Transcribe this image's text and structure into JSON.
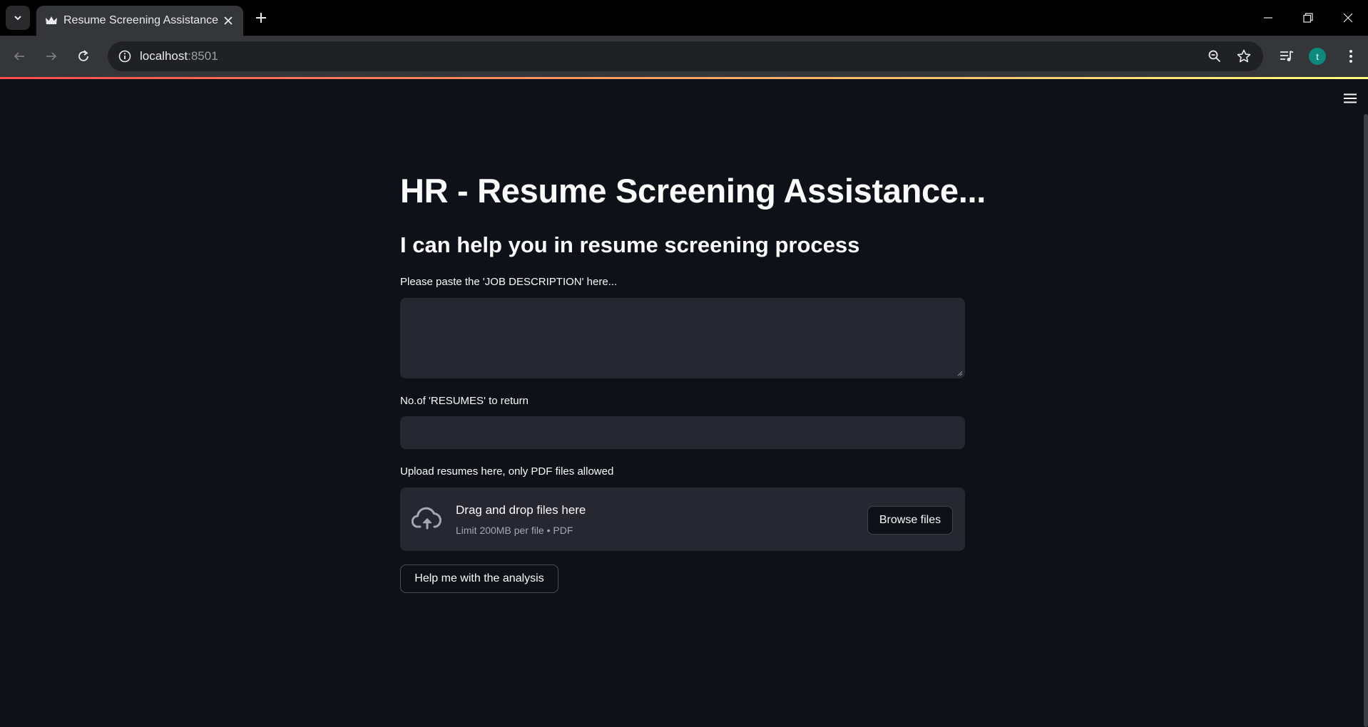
{
  "browser": {
    "tab_title": "Resume Screening Assistance",
    "url_host": "localhost",
    "url_port": ":8501",
    "profile_initial": "t"
  },
  "page": {
    "title": "HR - Resume Screening Assistance...",
    "subtitle": "I can help you in resume screening process",
    "job_description": {
      "label": "Please paste the 'JOB DESCRIPTION' here...",
      "value": ""
    },
    "num_resumes": {
      "label": "No.of 'RESUMES' to return",
      "value": ""
    },
    "uploader": {
      "label": "Upload resumes here, only PDF files allowed",
      "drop_text": "Drag and drop files here",
      "limit_text": "Limit 200MB per file • PDF",
      "browse_label": "Browse files"
    },
    "submit_label": "Help me with the analysis"
  },
  "colors": {
    "background": "#0e1117",
    "widget_bg": "#262730",
    "text": "#fafafa",
    "accent_gradient_start": "#ff4b4b",
    "accent_gradient_end": "#fffd80",
    "avatar": "#0b8a7d"
  },
  "icons": [
    "tab-search-icon",
    "streamlit-crown-icon",
    "close-icon",
    "plus-icon",
    "minimize-icon",
    "restore-icon",
    "back-arrow-icon",
    "forward-arrow-icon",
    "reload-icon",
    "site-info-icon",
    "zoom-icon",
    "bookmark-star-icon",
    "media-controls-icon",
    "kebab-menu-icon",
    "hamburger-menu-icon",
    "cloud-upload-icon"
  ]
}
